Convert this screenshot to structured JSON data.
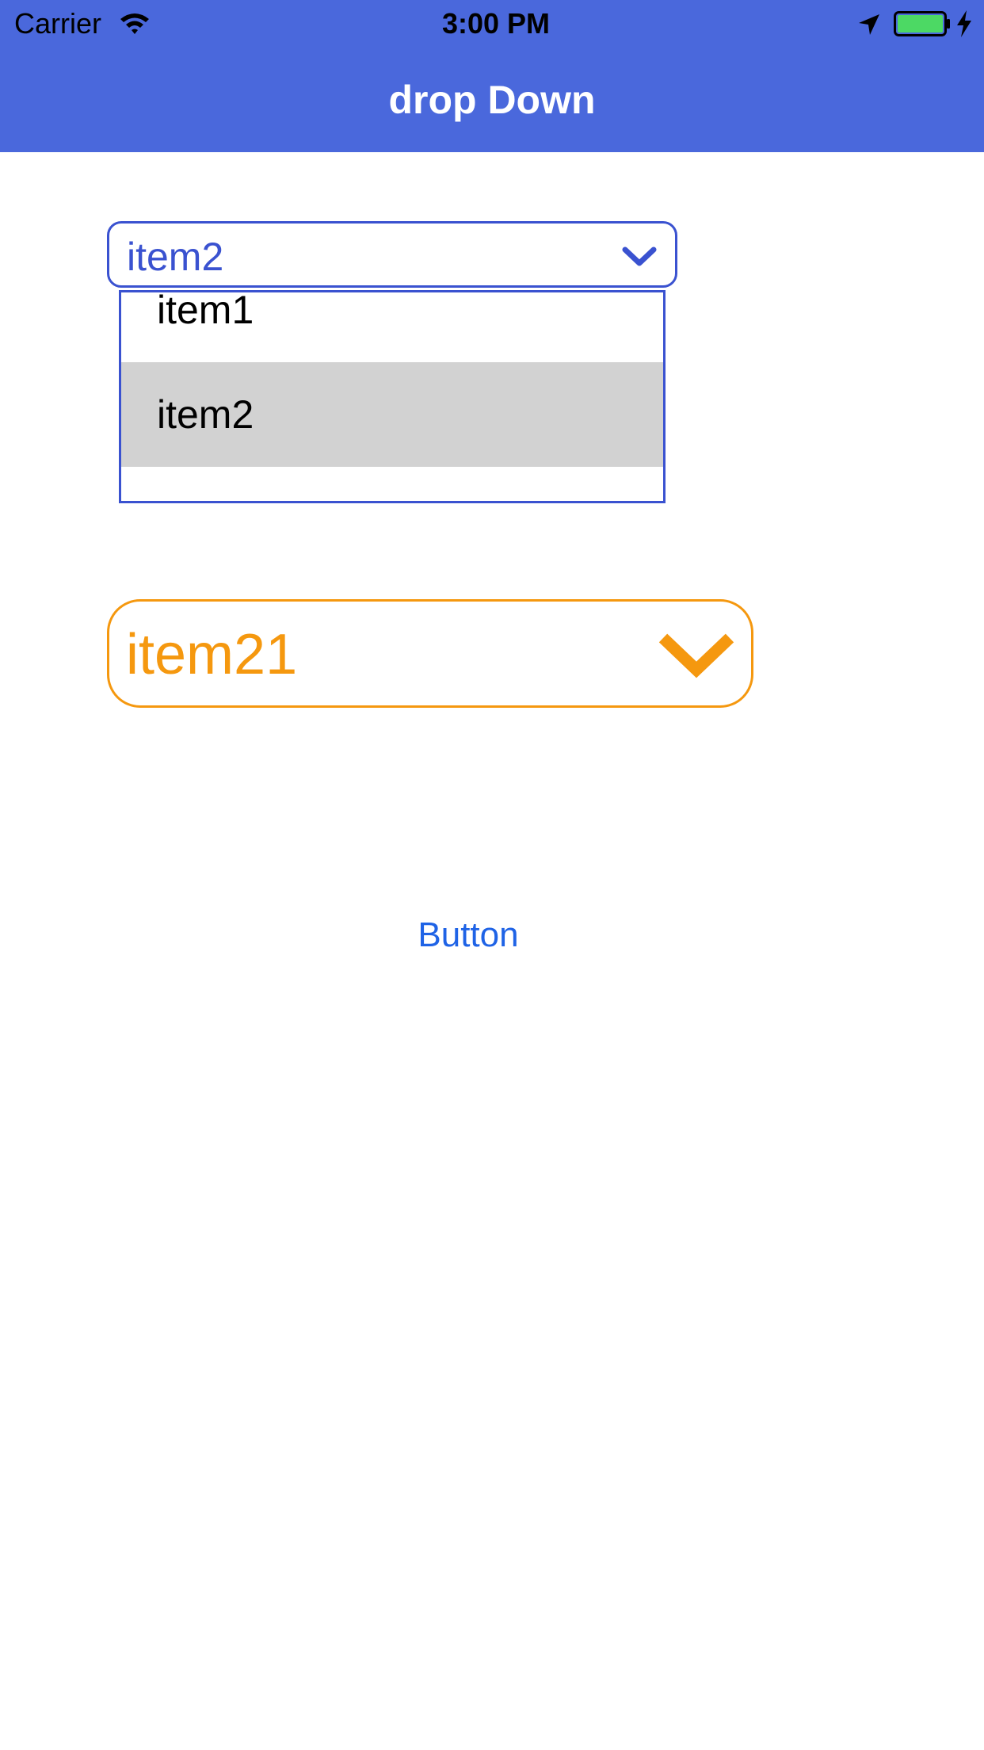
{
  "status_bar": {
    "carrier": "Carrier",
    "time": "3:00 PM",
    "icons": [
      "wifi-icon",
      "location-arrow-icon",
      "battery-icon",
      "charging-bolt-icon"
    ],
    "battery_color": "#4cd964"
  },
  "nav": {
    "title": "drop Down",
    "background_color": "#4a68dc"
  },
  "dropdown_primary": {
    "selected_value": "item2",
    "accent_color": "#3a52d0",
    "icon": "chevron-down-icon",
    "expanded": true,
    "options": [
      {
        "label": "item1"
      },
      {
        "label": "item2",
        "selected": true
      },
      {
        "label": ""
      }
    ],
    "selected_row_color": "#d2d2d2"
  },
  "dropdown_secondary": {
    "selected_value": "item21",
    "accent_color": "#f5980f",
    "icon": "chevron-down-icon",
    "expanded": false
  },
  "action_button": {
    "label": "Button",
    "color": "#1f63e6"
  }
}
